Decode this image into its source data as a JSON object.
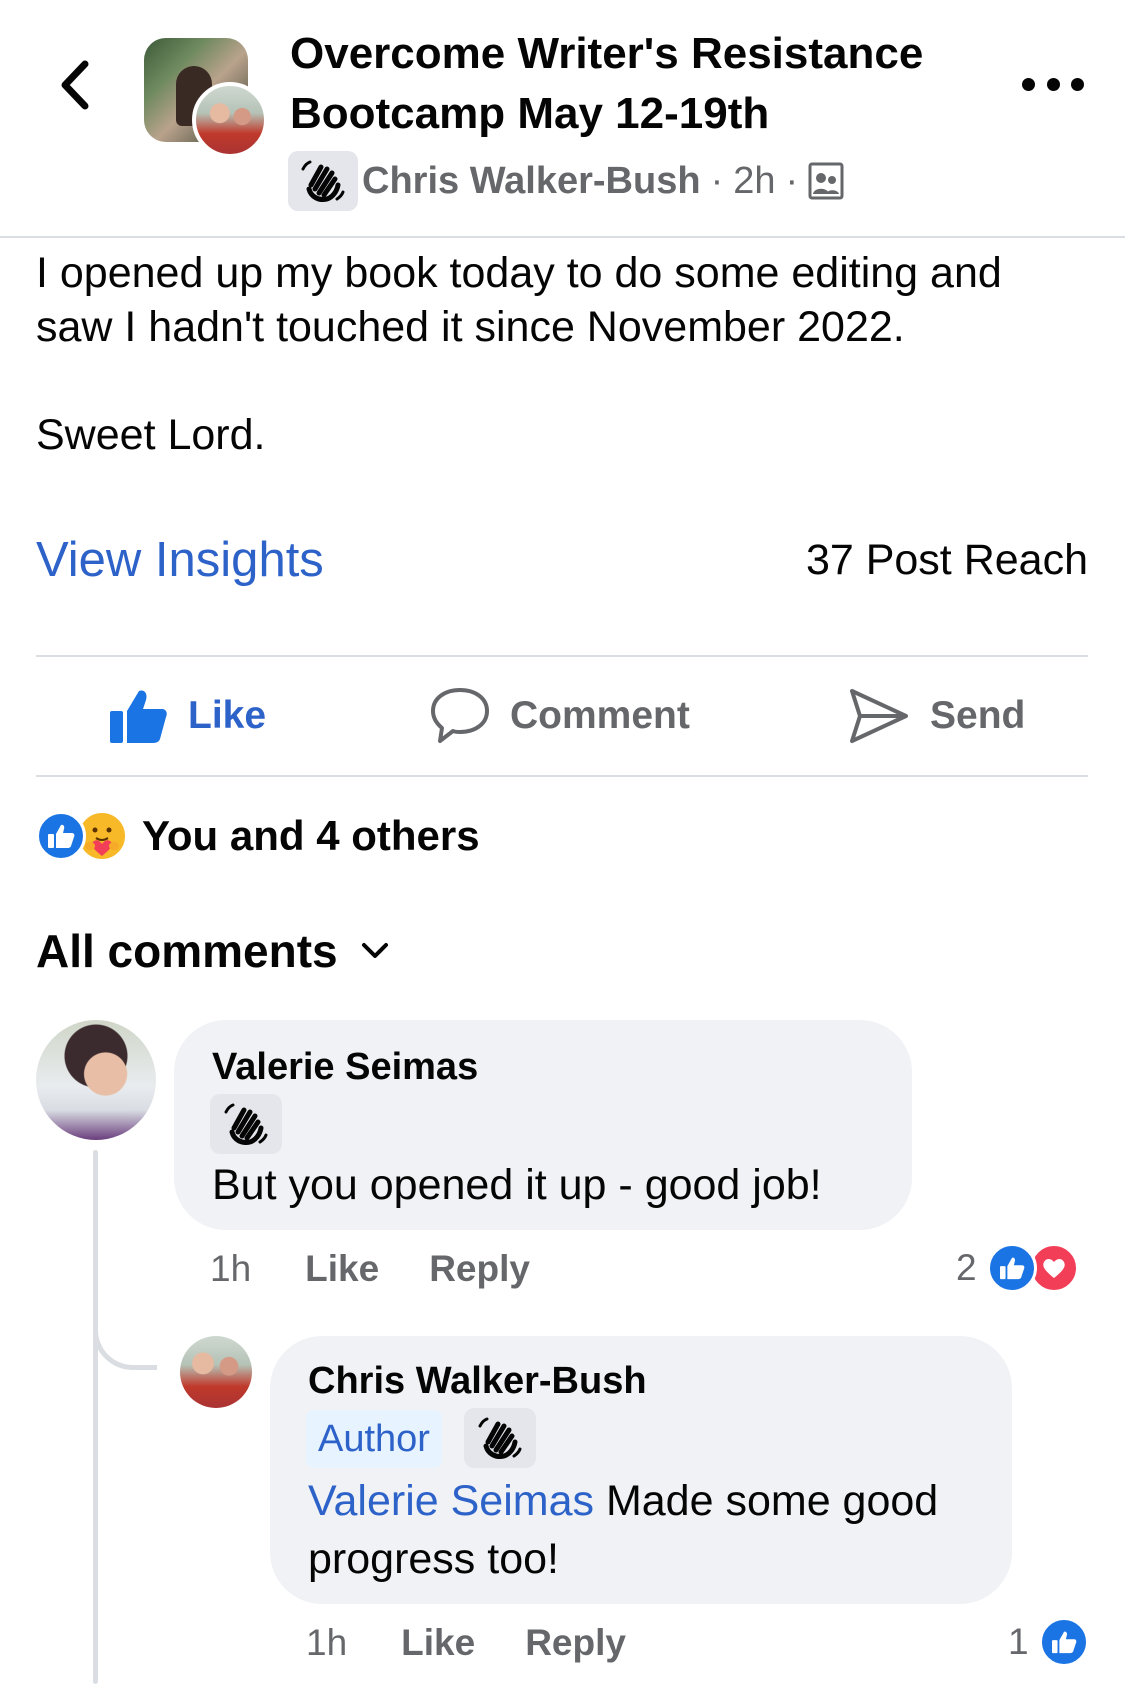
{
  "header": {
    "title": "Overcome Writer's Resistance Bootcamp May 12-19th",
    "author": "Chris Walker-Bush",
    "separator": "·",
    "time": "2h",
    "badge_icon": "waving-hand-icon",
    "privacy_icon": "members-icon"
  },
  "post": {
    "text": "I opened up my book today to do some editing and\nsaw I hadn't touched it since November 2022.\n\nSweet Lord.",
    "view_insights": "View Insights",
    "reach": "37 Post Reach"
  },
  "actions": {
    "like": "Like",
    "comment": "Comment",
    "send": "Send"
  },
  "reactions": {
    "summary": "You and 4 others",
    "types": [
      "like",
      "care"
    ]
  },
  "comments_filter": {
    "label": "All comments"
  },
  "comments": [
    {
      "name": "Valerie Seimas",
      "text": "But you opened it up - good job!",
      "time": "1h",
      "like": "Like",
      "reply": "Reply",
      "reaction_count": "2",
      "reactions": [
        "like",
        "love"
      ],
      "replies": [
        {
          "name": "Chris Walker-Bush",
          "role": "Author",
          "mention": "Valerie Seimas",
          "text_line1": " Made some good",
          "text_line2": "progress too!",
          "time": "1h",
          "like": "Like",
          "reply": "Reply",
          "reaction_count": "1",
          "reactions": [
            "like"
          ]
        }
      ]
    }
  ],
  "colors": {
    "link_blue": "#2d62c9",
    "like_blue": "#1b74e4",
    "love_red": "#f33e58",
    "bubble_gray": "#f0f2f5",
    "secondary_text": "#65676b"
  }
}
